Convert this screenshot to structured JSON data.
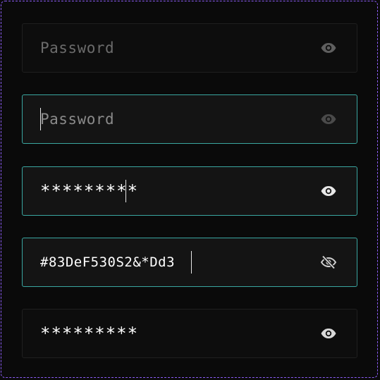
{
  "fields": [
    {
      "state": "placeholder",
      "placeholder": "Password",
      "value": "",
      "icon": "eye-icon",
      "icon_color": "#5f5f5f"
    },
    {
      "state": "focused-empty",
      "placeholder": "Password",
      "value": "",
      "icon": "eye-icon",
      "icon_color": "#4a4a4a"
    },
    {
      "state": "focused-masked",
      "placeholder": "Password",
      "value": "*********",
      "icon": "eye-icon",
      "icon_color": "#e8e8e8"
    },
    {
      "state": "focused-revealed",
      "placeholder": "Password",
      "value": "#83DeF530S2&*Dd3",
      "icon": "eye-off-icon",
      "icon_color": "#d0d0d0"
    },
    {
      "state": "filled-masked",
      "placeholder": "Password",
      "value": "*********",
      "icon": "eye-icon",
      "icon_color": "#d9d9d9"
    }
  ],
  "colors": {
    "focus_border": "#3aa6a0",
    "frame_border": "#8b5cf6"
  }
}
